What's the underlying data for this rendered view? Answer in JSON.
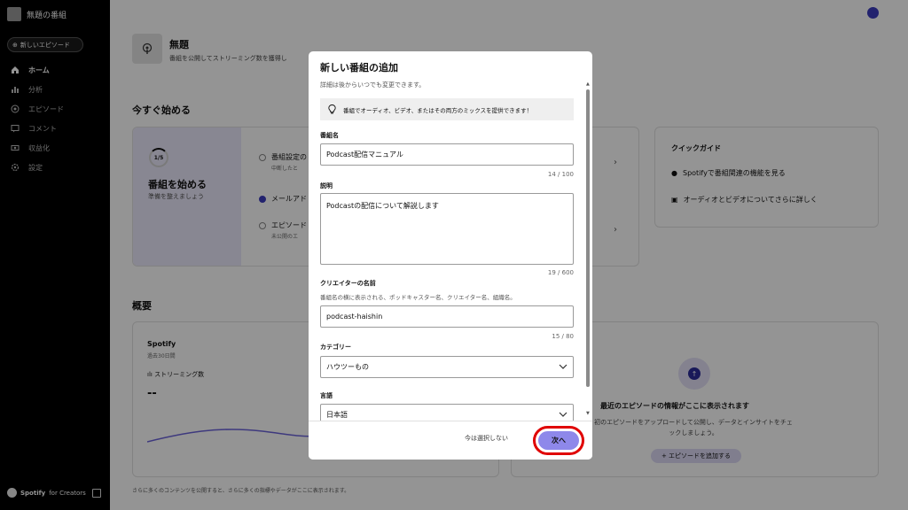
{
  "sidebar": {
    "show_name": "無題の番組",
    "new_episode_label": "新しいエピソード",
    "items": [
      {
        "label": "ホーム",
        "icon": "home-icon"
      },
      {
        "label": "分析",
        "icon": "analytics-icon"
      },
      {
        "label": "エピソード",
        "icon": "episodes-icon"
      },
      {
        "label": "コメント",
        "icon": "comment-icon"
      },
      {
        "label": "収益化",
        "icon": "monetize-icon"
      },
      {
        "label": "設定",
        "icon": "settings-icon"
      }
    ],
    "footer_brand": "Spotify",
    "footer_suffix": "for Creators"
  },
  "main": {
    "show_title": "無題",
    "show_subtitle": "番組を公開してストリーミング数を獲得し",
    "getting_started_title": "今すぐ始める",
    "progress_label": "1/5",
    "start_heading": "番組を始める",
    "start_sub": "準備を整えましょう",
    "steps": [
      {
        "label": "番組設定の",
        "sub": "中断したと"
      },
      {
        "label": "メールアド",
        "sub": ""
      },
      {
        "label": "エピソード",
        "sub": "未公開のエ"
      }
    ],
    "quick_guide": {
      "title": "クイックガイド",
      "items": [
        "Spotifyで番組関連の機能を見る",
        "オーディオとビデオについてさらに詳しく"
      ]
    },
    "overview_title": "概要",
    "overview_left": {
      "title": "Spotify",
      "sub": "過去30日間",
      "streams_label": "ストリーミング数",
      "streams_value": "--"
    },
    "overview_right": {
      "heading": "最近のエピソードの情報がここに表示されます",
      "sub": "初のエピソードをアップロードして公開し、データとインサイトをチェックしましょう。",
      "add_button": "エピソードを追加する"
    },
    "footnote": "さらに多くのコンテンツを公開すると、さらに多くの指標やデータがここに表示されます。"
  },
  "modal": {
    "title": "新しい番組の追加",
    "subtitle": "詳細は後からいつでも変更できます。",
    "info": "番組でオーディオ、ビデオ、またはその両方のミックスを提供できます！",
    "show_name": {
      "label": "番組名",
      "value": "Podcast配信マニュアル",
      "count": "14 / 100"
    },
    "description": {
      "label": "説明",
      "value": "Podcastの配信について解説します",
      "count": "19 / 600"
    },
    "creator": {
      "label": "クリエイターの名前",
      "help": "番組名の横に表示される、ポッドキャスター名、クリエイター名、組織名。",
      "value": "podcast-haishin",
      "count": "15 / 80"
    },
    "category": {
      "label": "カテゴリー",
      "value": "ハウツーもの"
    },
    "language": {
      "label": "言語",
      "value": "日本語"
    },
    "skip_label": "今は選択しない",
    "next_label": "次へ"
  },
  "colors": {
    "accent": "#8e88ea",
    "highlight_ring": "#e00000",
    "brand_dark": "#3b3bbd",
    "chart_line": "#6b63d9"
  }
}
